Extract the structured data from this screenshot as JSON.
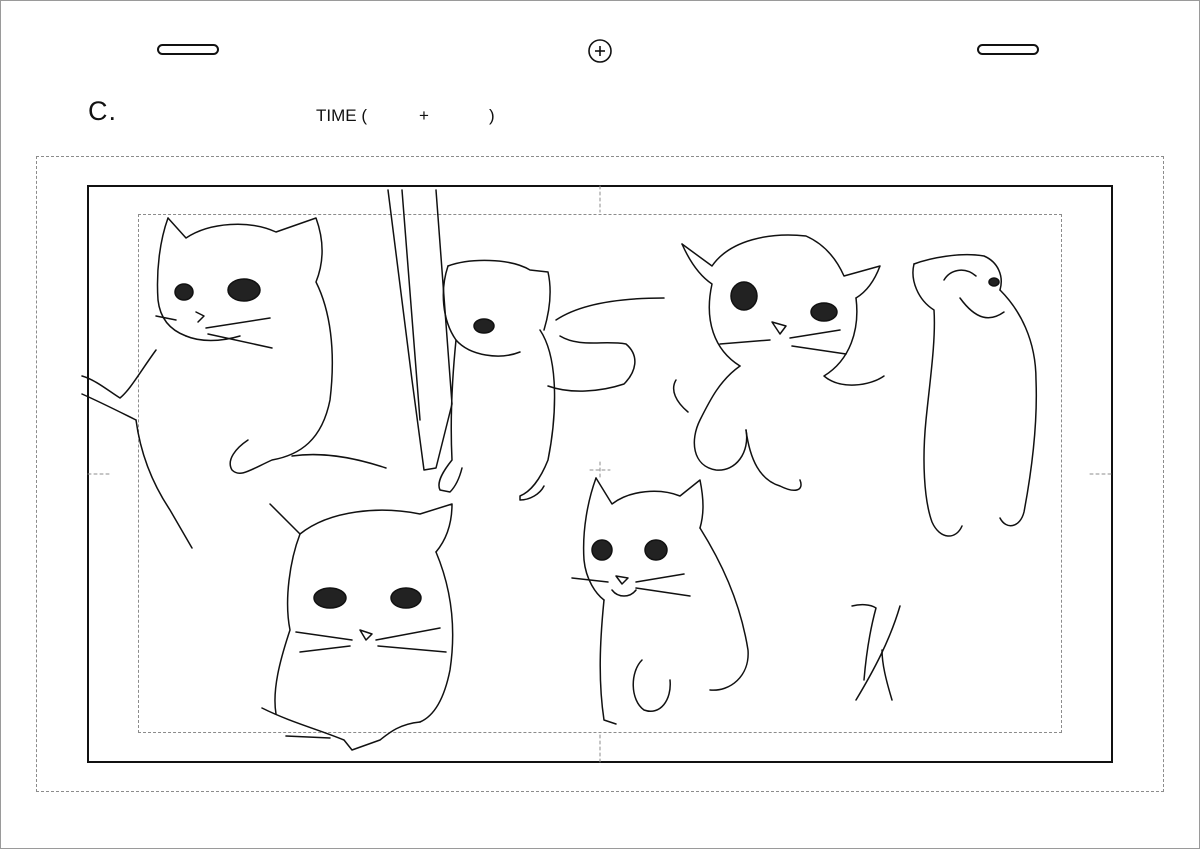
{
  "sheet": {
    "cut_label": "C.",
    "time_label": "TIME (",
    "time_plus": "+",
    "time_close": ")"
  },
  "icons": {
    "peg_hole_left": "peg-hole",
    "registration_mark": "crosshair-circle-icon",
    "peg_hole_right": "peg-hole"
  },
  "artwork": {
    "subject": "cat-sketches",
    "count": 6,
    "line_color": "#111111"
  }
}
